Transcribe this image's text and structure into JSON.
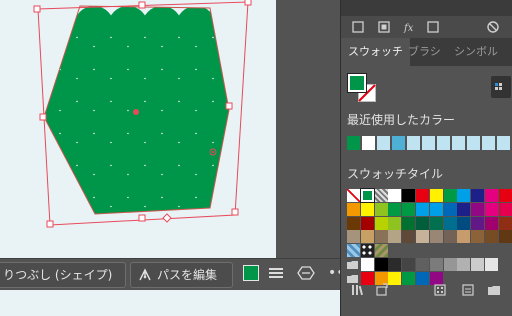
{
  "context_bar": {
    "live_paint_label": "りつぶし (シェイプ)",
    "edit_path_label": "パスを編集",
    "more_glyph": "••"
  },
  "panel": {
    "tabs": [
      {
        "label": "スウォッチ",
        "active": true
      },
      {
        "label": "ブラシ",
        "active": false
      },
      {
        "label": "シンボル",
        "active": false
      }
    ],
    "recent_colors_title": "最近使用したカラー",
    "swatch_library_title": "スウォッチタイル",
    "fill_color": "#00964a",
    "recent_colors": [
      "#00964a",
      "#ffffff",
      "#bfe3f1",
      "#4fb0d6",
      "#bfe3f1",
      "#bfe3f1",
      "#bfe3f1",
      "#bfe3f1",
      "#bfe3f1",
      "#bfe3f1",
      "#bfe3f1",
      "#bfe3f1"
    ],
    "swatch_rows": [
      [
        "none",
        "registration",
        "pattern-gray",
        "#ffffff",
        "#000000",
        "#e60012",
        "#fff100",
        "#009944",
        "#00a0e9",
        "#1d2088",
        "#e4007f",
        "#e60012"
      ],
      [
        "#f39800",
        "#fff100",
        "#8fc31f",
        "#009944",
        "#009944",
        "#00a0e9",
        "#00a0e9",
        "#0068b7",
        "#1d2088",
        "#920783",
        "#e4007f",
        "#e5004f"
      ],
      [
        "#6a3906",
        "#a40000",
        "#b8d200",
        "#8fc31f",
        "#007130",
        "#005e3c",
        "#00704f",
        "#006e8e",
        "#004c81",
        "#601986",
        "#a0006e",
        "#8f2e14"
      ],
      [
        "#a6937c",
        "#c9a063",
        "#8a7259",
        "#b3a485",
        "#5f4a3a",
        "#c7b299",
        "#998675",
        "#736357",
        "#c69c6d",
        "#8c6239",
        "#754c24",
        "#603813"
      ],
      [
        "pattern-blue",
        "pattern-dots",
        "pattern-leaf"
      ],
      [
        "folder",
        "#ffffff",
        "#000000",
        "#2b2b2b",
        "#454545",
        "#606060",
        "#7b7b7b",
        "#969696",
        "#b1b1b1",
        "#cccccc",
        "#e6e6e6"
      ],
      [
        "folder",
        "#e60012",
        "#f39800",
        "#fff100",
        "#009944",
        "#0068b7",
        "#920783"
      ]
    ]
  },
  "canvas": {
    "shape_color": "#00964a",
    "background_color": "#e9f2f5",
    "selection_color": "#e8495b"
  }
}
